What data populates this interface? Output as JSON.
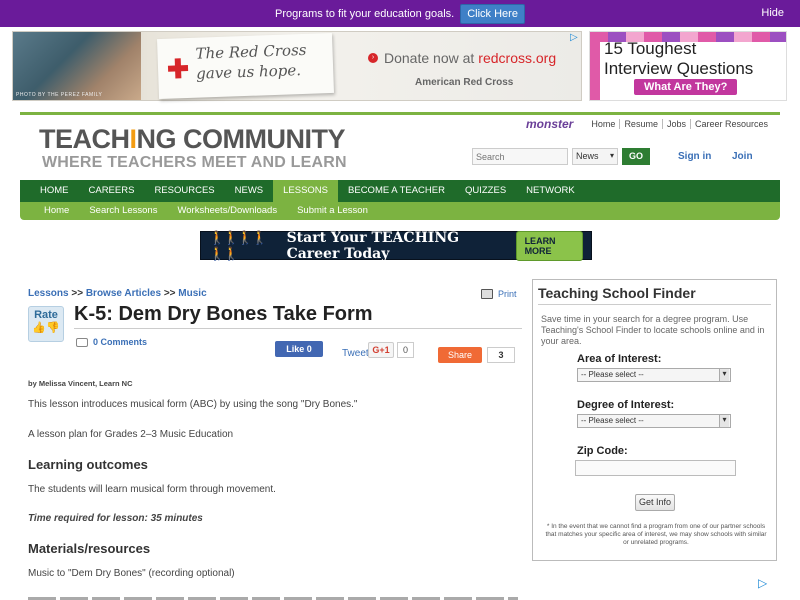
{
  "topbar": {
    "message": "Programs to fit your education goals.",
    "cta": "Click Here",
    "hide": "Hide"
  },
  "ad_left": {
    "photo_credit": "PHOTO BY THE PEREZ FAMILY",
    "note_line1": "The Red Cross",
    "note_line2": "gave us hope.",
    "donate_prefix": "Donate now at",
    "donate_link": "redcross.org",
    "org": "American Red Cross",
    "brand_color": "#d7262a"
  },
  "ad_right": {
    "headline_line1": "15 Toughest",
    "headline_line2": "Interview Questions",
    "cta": "What Are They?"
  },
  "header": {
    "logo_part1": "TEACH",
    "logo_i": "I",
    "logo_part2": "NG COMMUNITY",
    "tagline": "WHERE TEACHERS MEET AND LEARN",
    "partner": "monster",
    "toplinks": [
      "Home",
      "Resume",
      "Jobs",
      "Career Resources"
    ],
    "search_placeholder": "Search",
    "search_scope": "News",
    "go": "GO",
    "signin": "Sign in",
    "join": "Join"
  },
  "nav": {
    "primary": [
      "HOME",
      "CAREERS",
      "RESOURCES",
      "NEWS",
      "LESSONS",
      "BECOME A TEACHER",
      "QUIZZES",
      "NETWORK"
    ],
    "active": "LESSONS",
    "secondary": [
      "Home",
      "Search Lessons",
      "Worksheets/Downloads",
      "Submit a Lesson"
    ],
    "primary_color": "#1f6b2a",
    "secondary_color": "#7cb341"
  },
  "promo": {
    "text": "Start Your TEACHING Career Today",
    "cta": "LEARN MORE"
  },
  "article": {
    "breadcrumb": [
      "Lessons",
      "Browse Articles",
      "Music"
    ],
    "breadcrumb_sep": ">>",
    "print": "Print",
    "rate": "Rate",
    "title": "K-5: Dem Dry Bones Take Form",
    "comments": "0 Comments",
    "like": "Like 0",
    "tweet": "Tweet",
    "gplus": "G+1",
    "gplus_count": "0",
    "share": "Share",
    "share_count": "3",
    "byline": "by Melissa Vincent, Learn NC",
    "intro": "This lesson introduces musical form (ABC) by using the song \"Dry Bones.\"",
    "plan": "A lesson plan for Grades 2–3 Music Education",
    "h_outcomes": "Learning outcomes",
    "outcomes": "The students will learn musical form through movement.",
    "time": "Time required for lesson: 35 minutes",
    "h_materials": "Materials/resources",
    "materials": "Music to \"Dem Dry Bones\" (recording optional)"
  },
  "finder": {
    "title": "Teaching School Finder",
    "description": "Save time in your search for a degree program. Use Teaching's School Finder to locate schools online and in your area.",
    "area_label": "Area of Interest:",
    "area_value": "-- Please select --",
    "degree_label": "Degree of Interest:",
    "degree_value": "-- Please select --",
    "zip_label": "Zip Code:",
    "button": "Get Info",
    "note": "* In the event that we cannot find a program from one of our partner schools that matches your specific area of interest, we may show schools with similar or unrelated programs."
  }
}
